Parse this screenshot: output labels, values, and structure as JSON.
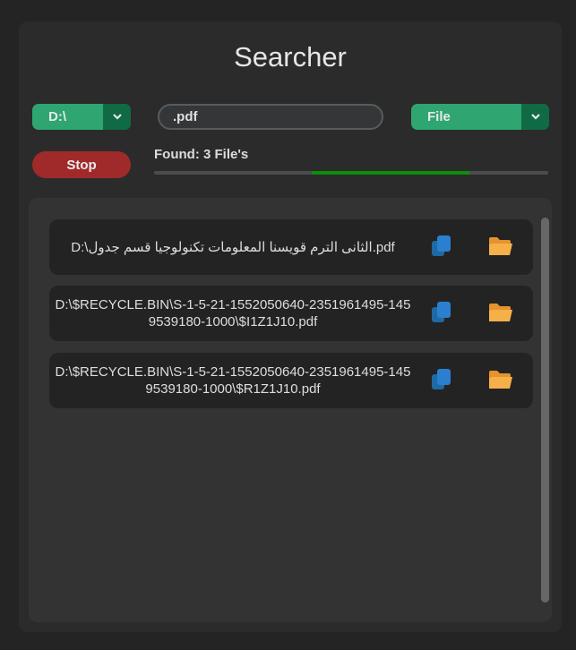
{
  "app": {
    "title": "Searcher"
  },
  "drive_select": {
    "value": "D:\\"
  },
  "search": {
    "value": ".pdf"
  },
  "type_select": {
    "value": "File"
  },
  "stop_button": {
    "label": "Stop"
  },
  "status": {
    "found_text": "Found: 3 File's"
  },
  "progress": {
    "fill_fraction": 0.4
  },
  "results": [
    {
      "path": "D:\\الثانى الترم قويسنا المعلومات تكنولوجيا قسم جدول.pdf"
    },
    {
      "path": "D:\\$RECYCLE.BIN\\S-1-5-21-1552050640-2351961495-1459539180-1000\\$I1Z1J10.pdf"
    },
    {
      "path": "D:\\$RECYCLE.BIN\\S-1-5-21-1552050640-2351961495-1459539180-1000\\$R1Z1J10.pdf"
    }
  ],
  "colors": {
    "accent": "#2fa572",
    "accent_dark": "#106a43",
    "stop": "#a02a2a",
    "progress": "#0b8f0b",
    "copy_icon": "#1f6aa5",
    "folder_icon": "#f4a838"
  },
  "icons": {
    "copy": "copy-icon",
    "open": "folder-open-icon",
    "dropdown": "chevron-down-icon"
  }
}
